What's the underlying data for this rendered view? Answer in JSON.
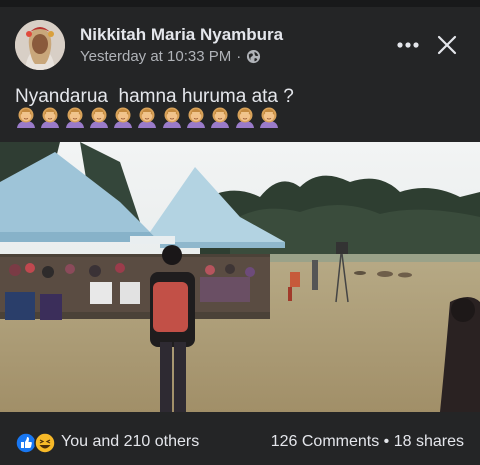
{
  "post": {
    "author": "Nikkitah Maria Nyambura",
    "timestamp": "Yesterday at 10:33 PM",
    "separator": "·",
    "privacy_icon": "globe-icon",
    "text": "Nyandarua  hamna huruma ata ?",
    "emoji_icon": "woman-facepalming-emoji",
    "emoji_count": 11
  },
  "header": {
    "more_icon": "more-dots-icon",
    "close_icon": "close-icon"
  },
  "reactions": {
    "icons": [
      "like-icon",
      "haha-icon"
    ],
    "summary": "You and 210 others",
    "comments": "126 Comments",
    "dot": "•",
    "shares": "18 shares"
  },
  "colors": {
    "background": "#242526",
    "text": "#e4e6eb",
    "secondary_text": "#b0b3b8",
    "like_blue": "#1877f2",
    "haha_yellow": "#f7b928"
  }
}
